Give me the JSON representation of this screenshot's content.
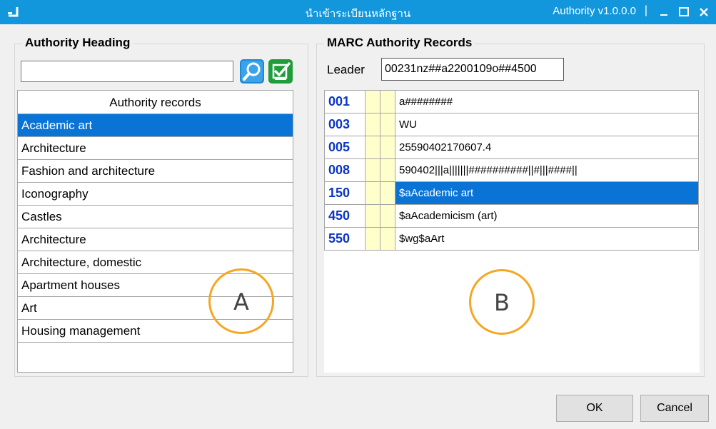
{
  "window": {
    "title": "นำเข้าระเบียนหลักฐาน",
    "version": "Authority v1.0.0.0",
    "separator": "|",
    "app_icon": "app-icon",
    "controls": [
      "minimize-icon",
      "maximize-icon",
      "close-icon"
    ],
    "titlebar_color": "#1296dc"
  },
  "left_panel": {
    "title": "Authority Heading",
    "search": {
      "value": "",
      "placeholder": ""
    },
    "search_icon": "search-icon",
    "confirm_icon": "check-icon",
    "list_header": "Authority records",
    "items": [
      "Academic art",
      "Architecture",
      "Fashion and architecture",
      "Iconography",
      "Castles",
      "Architecture",
      "Architecture, domestic",
      "Apartment houses",
      "Art",
      "Housing management"
    ],
    "selected_index": 0
  },
  "right_panel": {
    "title": "MARC Authority Records",
    "leader_label": "Leader",
    "leader_value": "00231nz##a2200109o##4500",
    "rows": [
      {
        "tag": "001",
        "ind1": "",
        "ind2": "",
        "value": "a########"
      },
      {
        "tag": "003",
        "ind1": "",
        "ind2": "",
        "value": "WU"
      },
      {
        "tag": "005",
        "ind1": "",
        "ind2": "",
        "value": "25590402170607.4"
      },
      {
        "tag": "008",
        "ind1": "",
        "ind2": "",
        "value": "590402|||a|||||||##########||#|||####||"
      },
      {
        "tag": "150",
        "ind1": "",
        "ind2": "",
        "value": "$aAcademic art"
      },
      {
        "tag": "450",
        "ind1": "",
        "ind2": "",
        "value": "$aAcademicism (art)"
      },
      {
        "tag": "550",
        "ind1": "",
        "ind2": "",
        "value": "$wg$aArt"
      }
    ],
    "selected_index": 4
  },
  "annotations": {
    "a": "A",
    "b": "B"
  },
  "buttons": {
    "ok": "OK",
    "cancel": "Cancel"
  },
  "colors": {
    "selection": "#0a74d6",
    "tag_text": "#0b35c6",
    "indicator_bg": "#ffffcc",
    "annotation": "#f5a623"
  }
}
